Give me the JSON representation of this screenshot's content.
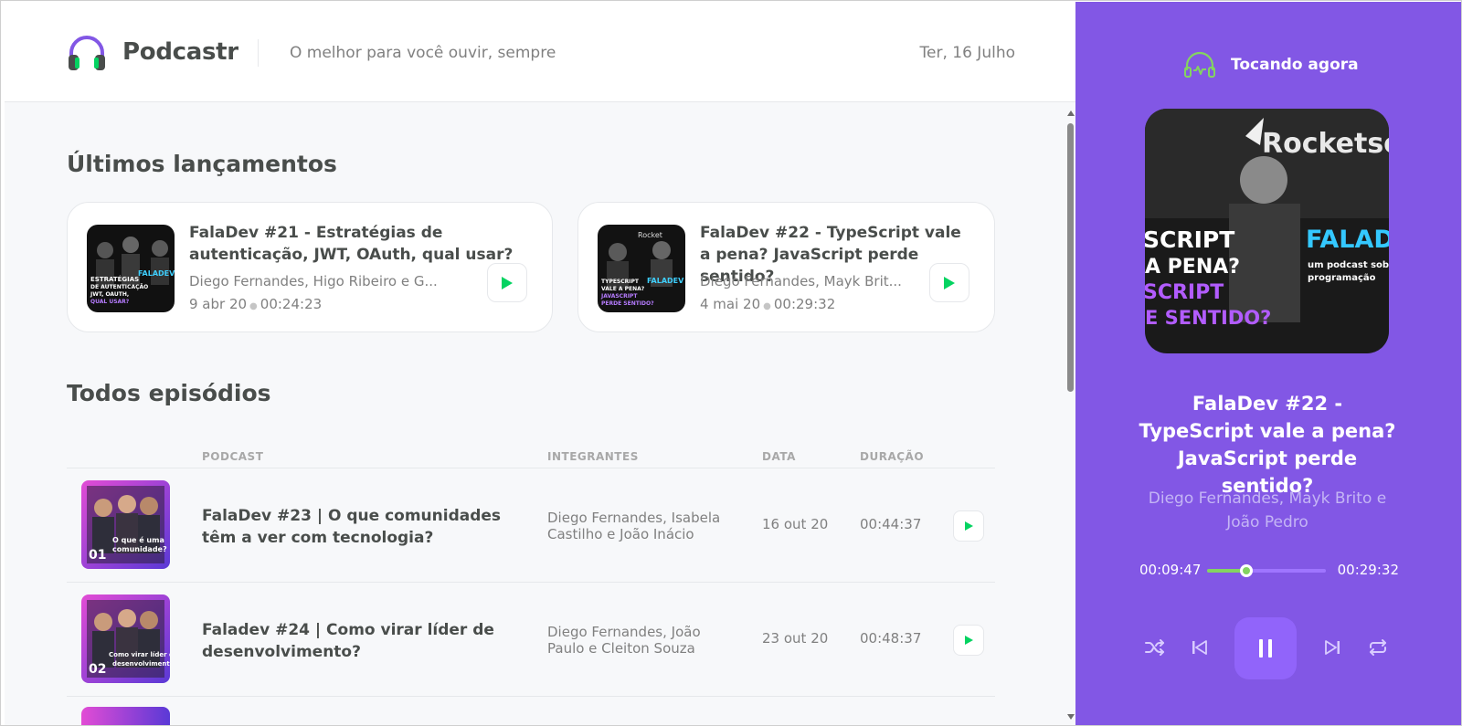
{
  "colors": {
    "brand_purple": "#8257e5",
    "accent_green": "#04d361",
    "text_dark": "#494d4b",
    "text_muted": "#808080",
    "background": "#f7f8fa"
  },
  "header": {
    "logo_text": "Podcastr",
    "tagline": "O melhor para você ouvir, sempre",
    "date": "Ter, 16 Julho"
  },
  "latest": {
    "title": "Últimos lançamentos",
    "episodes": [
      {
        "title": "FalaDev #21 - Estratégias de autenticação, JWT, OAuth, qual usar?",
        "members": "Diego Fernandes, Higo Ribeiro e G...",
        "date": "9 abr 20",
        "duration": "00:24:23",
        "thumb": {
          "lines": [
            "ESTRATÉGIAS",
            "DE AUTENTICAÇÃO",
            "JWT, OAUTH,",
            "QUAL USAR?"
          ],
          "badge": "FALADEV"
        }
      },
      {
        "title": "FalaDev #22 - TypeScript vale a pena? JavaScript perde sentido?",
        "members": "Diego Fernandes, Mayk Brit...",
        "date": "4 mai 20",
        "duration": "00:29:32",
        "thumb": {
          "lines": [
            "TYPESCRIPT",
            "VALE A PENA?",
            "JAVASCRIPT",
            "PERDE SENTIDO?"
          ],
          "badge": "FALADEV"
        }
      }
    ]
  },
  "all": {
    "title": "Todos episódios",
    "columns": [
      "PODCAST",
      "INTEGRANTES",
      "DATA",
      "DURAÇÃO"
    ],
    "rows": [
      {
        "title": "FalaDev #23 | O que comunidades têm a ver com tecnologia?",
        "members": "Diego Fernandes, Isabela Castilho e João Inácio",
        "date": "16 out 20",
        "duration": "00:44:37",
        "thumb": {
          "number": "01",
          "caption": "O que é uma comunidade?"
        }
      },
      {
        "title": "Faladev #24 | Como virar líder de desenvolvimento?",
        "members": "Diego Fernandes, João Paulo e Cleiton Souza",
        "date": "23 out 20",
        "duration": "00:48:37",
        "thumb": {
          "number": "02",
          "caption": "Como virar líder de desenvolvimento?"
        }
      }
    ]
  },
  "player": {
    "label": "Tocando agora",
    "title": "FalaDev #22 - TypeScript vale a pena? JavaScript perde sentido?",
    "members": "Diego Fernandes, Mayk Brito e João Pedro",
    "current_time": "00:09:47",
    "total_time": "00:29:32",
    "progress": 0.33,
    "cover": {
      "brand": "Rocketse",
      "lines": [
        "SCRIPT",
        "A PENA?",
        "SCRIPT",
        "E SENTIDO?"
      ],
      "badge": "FALAD",
      "badge_sub": "um podcast sob programação"
    },
    "controls": [
      "shuffle-icon",
      "previous-icon",
      "pause-icon",
      "next-icon",
      "repeat-icon"
    ]
  }
}
